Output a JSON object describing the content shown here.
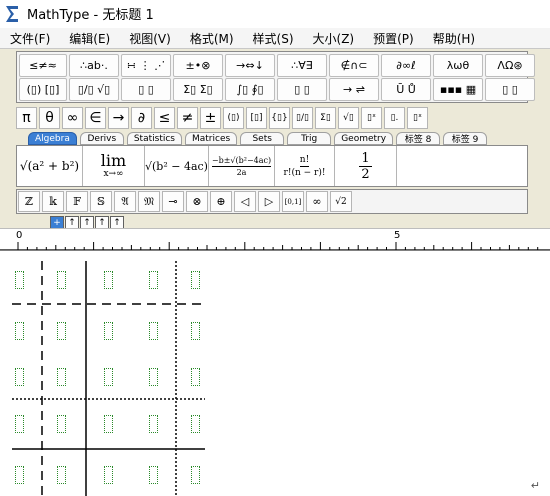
{
  "window": {
    "title": "MathType - 无标题 1"
  },
  "menu": [
    "文件(F)",
    "编辑(E)",
    "视图(V)",
    "格式(M)",
    "样式(S)",
    "大小(Z)",
    "预置(P)",
    "帮助(H)"
  ],
  "palette_row1": [
    "≤≠≈",
    "∴ab·.",
    "∺ ⋮ ⋰",
    "±•⊗",
    "→⇔↓",
    "∴∀∃",
    "∉∩⊂",
    "∂∞ℓ",
    "λωθ",
    "ΛΩ⊛"
  ],
  "palette_row2": [
    "(▯) [▯]",
    "▯/▯ √▯",
    "▯ ▯",
    "Σ▯ Σ▯",
    "∫▯ ∮▯",
    "▯ ▯",
    "→ ⇌",
    "Ū Ů",
    "▪▪▪ ▦",
    "▯ ▯"
  ],
  "symbols": [
    "π",
    "θ",
    "∞",
    "∈",
    "→",
    "∂",
    "≤",
    "≠",
    "±",
    "(▯)",
    "[▯]",
    "{▯}",
    "▯/▯",
    "Σ▯",
    "√▯",
    "▯ˣ",
    "▯.",
    "▯ˣ"
  ],
  "tabs": [
    "Algebra",
    "Derivs",
    "Statistics",
    "Matrices",
    "Sets",
    "Trig",
    "Geometry",
    "标签 8",
    "标签 9"
  ],
  "templates": {
    "t1": "√(a² + b²)",
    "t2_top": "lim",
    "t2_bot": "x→∞",
    "t3": "√(b² − 4ac)",
    "t4_top": "−b±√(b²−4ac)",
    "t4_bot": "2a",
    "t5_top": "n!",
    "t5_bot": "r!(n − r)!",
    "t6_top": "1",
    "t6_bot": "2"
  },
  "small_buttons": [
    "ℤ",
    "𝕜",
    "𝔽",
    "𝕊",
    "𝔄",
    "𝔐",
    "⊸",
    "⊗",
    "⊕",
    "◁",
    "▷",
    "[0,1]",
    "∞",
    "√2"
  ],
  "size_buttons": [
    "+",
    "↑",
    "↑",
    "↑",
    "↑"
  ],
  "ruler": {
    "left_label": "0",
    "mid_label": "5"
  },
  "document": {
    "return_mark": "↵"
  }
}
